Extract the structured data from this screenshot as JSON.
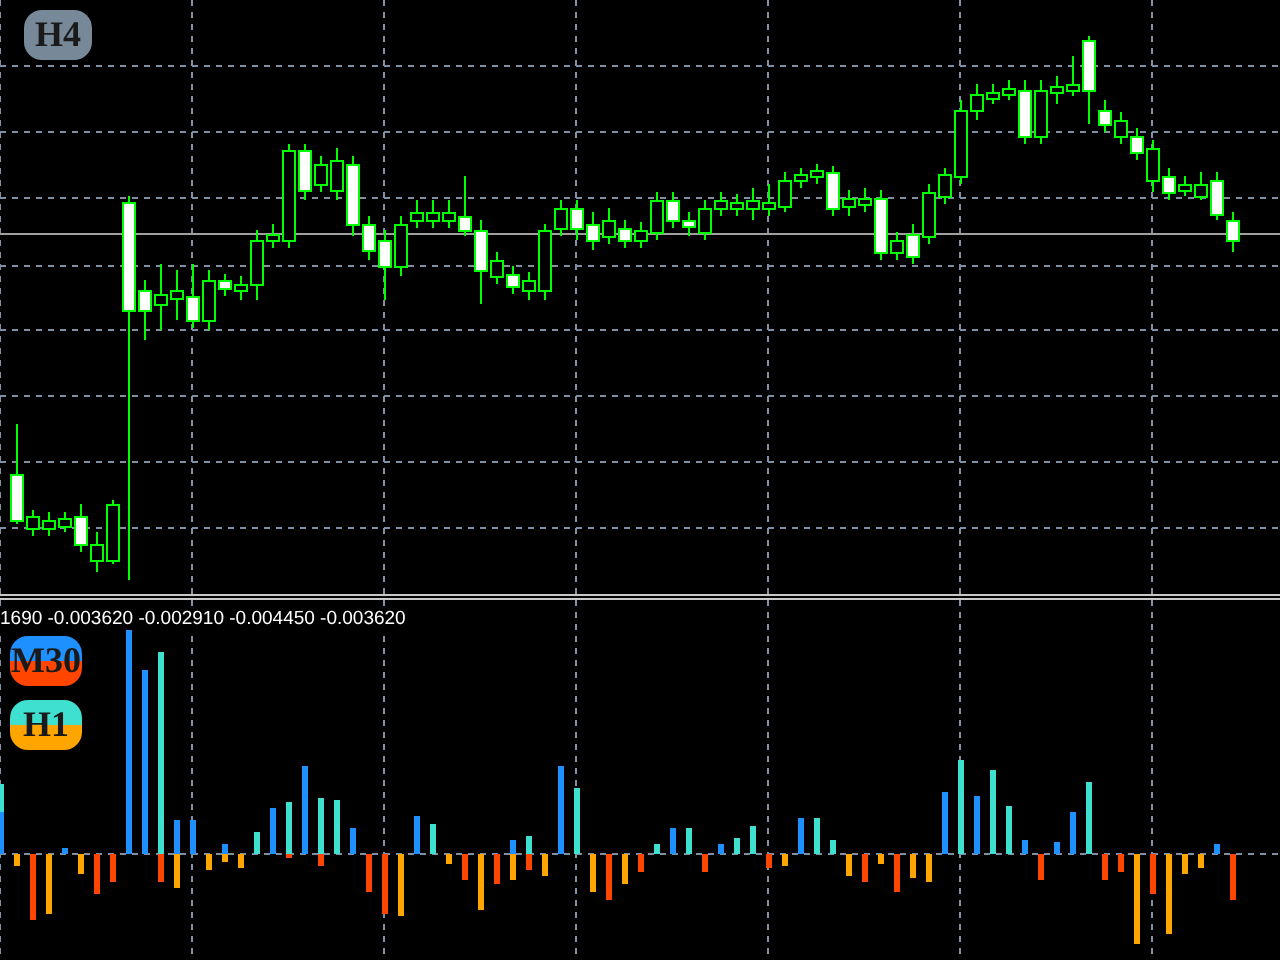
{
  "main_chart": {
    "timeframe_badge": "H4"
  },
  "indicator": {
    "values_line": "1690 -0.003620 -0.002910 -0.004450 -0.003620",
    "badges": [
      {
        "label": "M30",
        "kind": "m30"
      },
      {
        "label": "H1",
        "kind": "h1"
      }
    ]
  }
}
